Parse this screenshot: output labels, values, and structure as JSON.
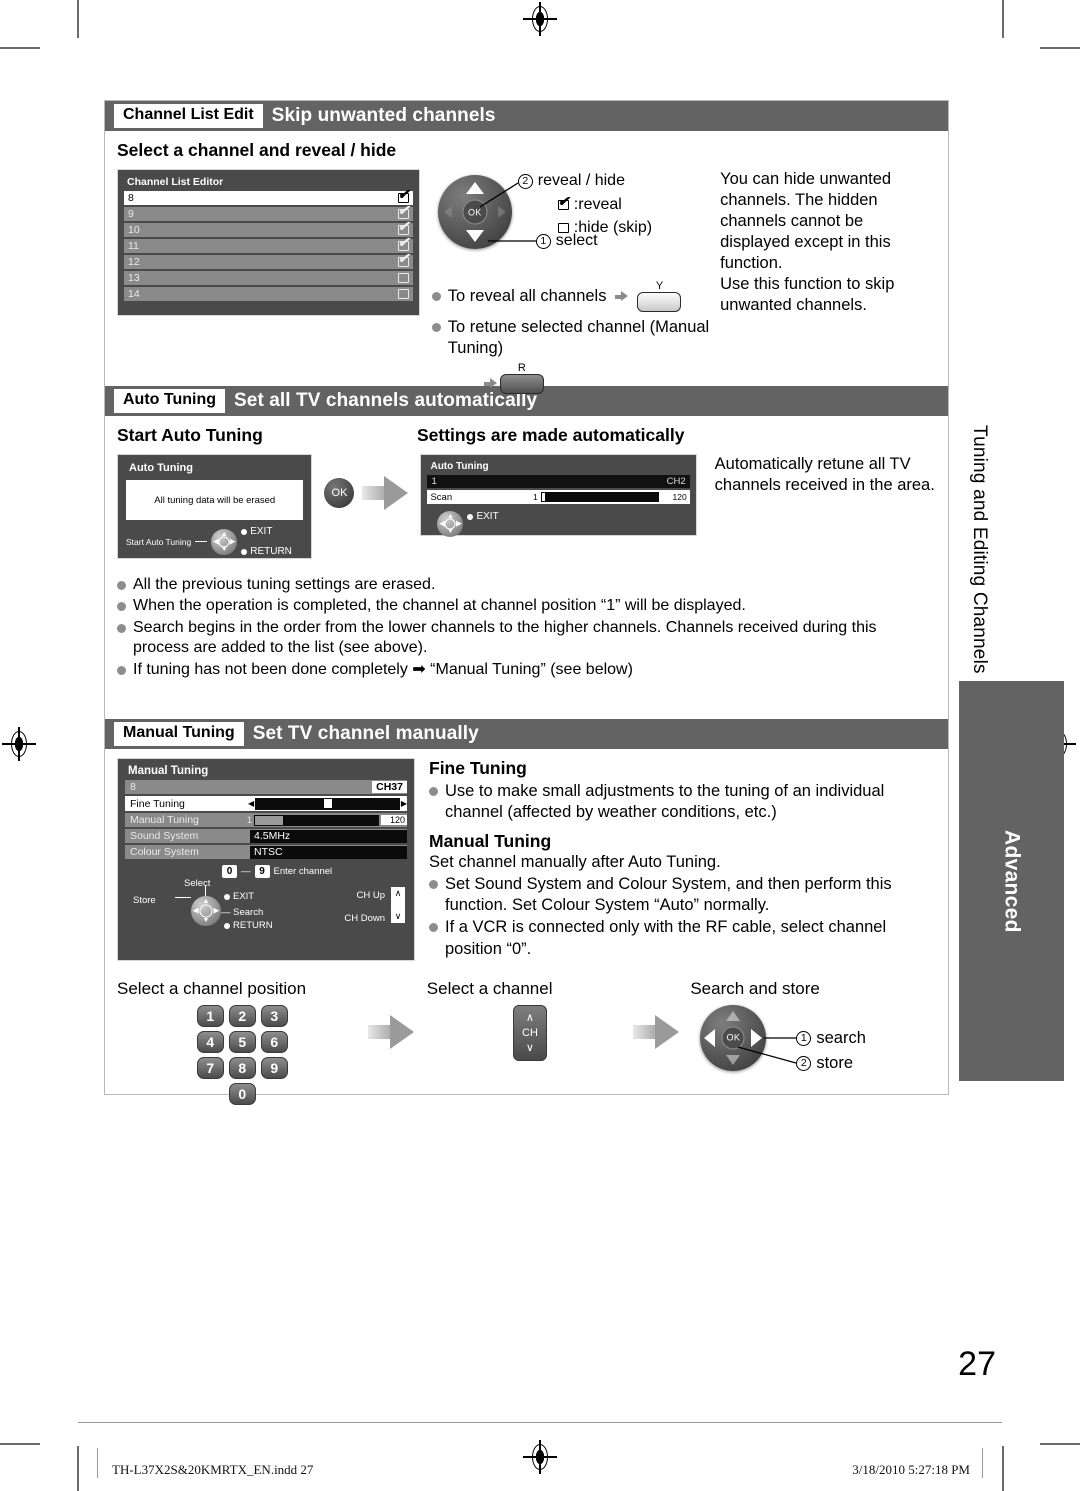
{
  "page": {
    "number": "27",
    "footer_file": "TH-L37X2S&20KMRTX_EN.indd   27",
    "footer_date": "3/18/2010   5:27:18 PM"
  },
  "side_tabs": {
    "chapter": "Tuning and Editing Channels",
    "category": "Advanced"
  },
  "sections": [
    {
      "chip": "Channel List Edit",
      "title": "Skip unwanted channels",
      "heading": "Select a channel and reveal / hide",
      "osd": {
        "title": "Channel List Editor",
        "rows": [
          {
            "channel": "8",
            "checked": true,
            "style": "hl"
          },
          {
            "channel": "9",
            "checked": true,
            "style": "dim"
          },
          {
            "channel": "10",
            "checked": true,
            "style": "dim"
          },
          {
            "channel": "11",
            "checked": true,
            "style": "dim"
          },
          {
            "channel": "12",
            "checked": true,
            "style": "dim"
          },
          {
            "channel": "13",
            "checked": false,
            "style": "dim"
          },
          {
            "channel": "14",
            "checked": false,
            "style": "dim"
          }
        ]
      },
      "callouts": {
        "step2": "reveal / hide",
        "step1": "select",
        "legend_reveal": ":reveal",
        "legend_hide": ":hide (skip)"
      },
      "bullets": [
        {
          "text": "To reveal all channels",
          "arrow": true,
          "key": "Y"
        },
        {
          "text": "To retune selected channel (Manual Tuning)",
          "arrow": true,
          "key": "R"
        }
      ],
      "note": "You can hide unwanted channels. The hidden channels cannot be displayed except in this function.\nUse this function to skip unwanted channels."
    },
    {
      "chip": "Auto Tuning",
      "title": "Set all TV channels automatically",
      "left_heading": "Start Auto Tuning",
      "right_heading": "Settings are made automatically",
      "osd_left": {
        "title": "Auto Tuning",
        "message": "All tuning data will be erased",
        "hint_label": "Start Auto Tuning",
        "keys": [
          "EXIT",
          "RETURN"
        ]
      },
      "ok_button": "OK",
      "osd_right": {
        "title": "Auto Tuning",
        "row_channel": "1",
        "row_channel_right": "CH2",
        "scan_label": "Scan",
        "scan_min": "1",
        "scan_max": "120",
        "exit_key": "EXIT"
      },
      "note": "Automatically retune all TV channels received in the area.",
      "notes": [
        "All the previous tuning settings are erased.",
        "When the operation is completed, the channel at channel position “1” will be displayed.",
        "Search begins in the order from the lower channels to the higher channels. Channels received during this process are added to the list (see above).",
        "If tuning has not been done completely ➡ “Manual Tuning” (see below)"
      ]
    },
    {
      "chip": "Manual Tuning",
      "title": "Set TV channel manually",
      "osd": {
        "title": "Manual Tuning",
        "rows": [
          {
            "label": "8",
            "value": "CH37",
            "style": "dim"
          },
          {
            "label": "Fine Tuning",
            "value": "",
            "style": "hl"
          },
          {
            "label": "Manual Tuning",
            "value_left": "1",
            "value_right": "120",
            "style": "dim"
          },
          {
            "label": "Sound System",
            "value": "4.5MHz",
            "style": "dim"
          },
          {
            "label": "Colour System",
            "value": "NTSC",
            "style": "dim"
          }
        ],
        "hints": {
          "select": "Select",
          "store": "Store",
          "search": "Search",
          "exit": "EXIT",
          "return": "RETURN",
          "enter_channel": "Enter channel",
          "key_from": "0",
          "key_to": "9",
          "ch_up": "CH Up",
          "ch_down": "CH Down"
        }
      },
      "fine_tuning": {
        "heading": "Fine Tuning",
        "bullets": [
          "Use to make small adjustments to the tuning of an individual channel (affected by weather conditions, etc.)"
        ]
      },
      "manual_tuning": {
        "heading": "Manual Tuning",
        "lead": "Set channel manually after Auto Tuning.",
        "bullets": [
          "Set Sound System and Colour System, and then perform this function. Set Colour System “Auto” normally.",
          "If a VCR is connected only with the RF cable, select channel position “0”."
        ]
      },
      "steps": [
        {
          "caption": "Select a channel position",
          "keys": [
            "1",
            "2",
            "3",
            "4",
            "5",
            "6",
            "7",
            "8",
            "9",
            "0"
          ]
        },
        {
          "caption": "Select a channel",
          "key_label": "CH"
        },
        {
          "caption": "Search and store",
          "step1": "search",
          "step2": "store"
        }
      ]
    }
  ]
}
